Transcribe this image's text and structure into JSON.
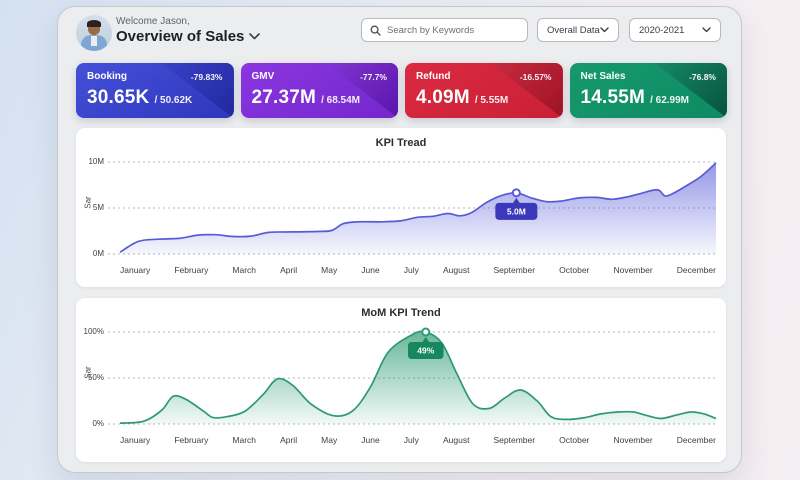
{
  "header": {
    "welcome": "Welcome Jason,",
    "title": "Overview of Sales",
    "search_placeholder": "Search by Keywords",
    "data_filter": "Overall Data",
    "year_filter": "2020-2021"
  },
  "icons": {
    "search": "magnifier",
    "title_dropdown": "chevron-down",
    "filter_dropdown": "chevron-down"
  },
  "cards": [
    {
      "label": "Booking",
      "value": "30.65K",
      "secondary": "/ 50.62K",
      "delta": "-79.83%",
      "color_from": "#4450d8",
      "color_to": "#2f36bd",
      "corner_from": "#4a52e2",
      "corner_to": "#21289e"
    },
    {
      "label": "GMV",
      "value": "27.37M",
      "secondary": "/ 68.54M",
      "delta": "-77.7%",
      "color_from": "#8a36e0",
      "color_to": "#7427cc",
      "corner_from": "#9b4ceb",
      "corner_to": "#5a15ab"
    },
    {
      "label": "Refund",
      "value": "4.09M",
      "secondary": "/ 5.55M",
      "delta": "-16.57%",
      "color_from": "#da2a41",
      "color_to": "#c92036",
      "corner_from": "#e33c52",
      "corner_to": "#9e1226"
    },
    {
      "label": "Net Sales",
      "value": "14.55M",
      "secondary": "/ 62.99M",
      "delta": "-76.8%",
      "color_from": "#16996e",
      "color_to": "#0d8a61",
      "corner_from": "#1fae81",
      "corner_to": "#07523c"
    }
  ],
  "chart_data": [
    {
      "type": "area",
      "title": "KPI Tread",
      "ylabel": "Sar",
      "unit": "M",
      "ylim": [
        0,
        10
      ],
      "yticks": [
        "10M",
        "5M",
        "0M"
      ],
      "grid": "dashed",
      "categories": [
        "January",
        "February",
        "March",
        "April",
        "May",
        "June",
        "July",
        "August",
        "September",
        "October",
        "November",
        "December"
      ],
      "values": [
        0.3,
        2.0,
        2.0,
        2.4,
        2.6,
        3.5,
        4.1,
        6.4,
        6.6,
        6.0,
        6.9,
        9.9
      ],
      "tooltip": {
        "label": "5.0M",
        "month": "September"
      },
      "marker": {
        "x": 0.665,
        "value": 6.65
      },
      "line_color": "#585cd4",
      "fill_color": "#6b6fdd",
      "tooltip_color": "#3b38bb",
      "curve": [
        [
          0,
          0.2
        ],
        [
          0.03,
          1.35
        ],
        [
          0.06,
          1.6
        ],
        [
          0.1,
          1.7
        ],
        [
          0.13,
          2.05
        ],
        [
          0.16,
          2.1
        ],
        [
          0.19,
          1.9
        ],
        [
          0.22,
          1.95
        ],
        [
          0.25,
          2.35
        ],
        [
          0.29,
          2.4
        ],
        [
          0.33,
          2.45
        ],
        [
          0.355,
          2.55
        ],
        [
          0.375,
          3.3
        ],
        [
          0.4,
          3.5
        ],
        [
          0.44,
          3.5
        ],
        [
          0.47,
          3.6
        ],
        [
          0.5,
          4.0
        ],
        [
          0.525,
          4.1
        ],
        [
          0.55,
          4.4
        ],
        [
          0.57,
          4.15
        ],
        [
          0.59,
          4.5
        ],
        [
          0.615,
          5.6
        ],
        [
          0.64,
          6.35
        ],
        [
          0.665,
          6.65
        ],
        [
          0.69,
          6.1
        ],
        [
          0.715,
          5.7
        ],
        [
          0.74,
          5.75
        ],
        [
          0.77,
          6.1
        ],
        [
          0.8,
          6.15
        ],
        [
          0.825,
          5.95
        ],
        [
          0.85,
          6.2
        ],
        [
          0.875,
          6.6
        ],
        [
          0.895,
          6.95
        ],
        [
          0.905,
          6.9
        ],
        [
          0.915,
          6.3
        ],
        [
          0.93,
          6.65
        ],
        [
          0.95,
          7.4
        ],
        [
          0.97,
          8.2
        ],
        [
          0.985,
          9.0
        ],
        [
          1.0,
          9.9
        ]
      ]
    },
    {
      "type": "area",
      "title": "MoM KPI Trend",
      "ylabel": "Sar",
      "unit": "%",
      "ylim": [
        0,
        100
      ],
      "yticks": [
        "100%",
        "50%",
        "0%"
      ],
      "grid": "dashed",
      "categories": [
        "January",
        "February",
        "March",
        "April",
        "May",
        "June",
        "July",
        "August",
        "September",
        "October",
        "November",
        "December"
      ],
      "values": [
        1,
        30,
        7,
        49,
        9,
        78,
        100,
        20,
        37,
        8,
        13,
        10
      ],
      "tooltip": {
        "label": "49%",
        "month": "July"
      },
      "marker": {
        "x": 0.513,
        "value": 100
      },
      "line_color": "#2e9974",
      "fill_color": "#2c9c74",
      "tooltip_color": "#17875f",
      "curve": [
        [
          0,
          1
        ],
        [
          0.04,
          3
        ],
        [
          0.07,
          15
        ],
        [
          0.089,
          30
        ],
        [
          0.11,
          27
        ],
        [
          0.14,
          14
        ],
        [
          0.156,
          7
        ],
        [
          0.18,
          8
        ],
        [
          0.21,
          14
        ],
        [
          0.24,
          32
        ],
        [
          0.264,
          49
        ],
        [
          0.29,
          42
        ],
        [
          0.32,
          22
        ],
        [
          0.358,
          9
        ],
        [
          0.39,
          14
        ],
        [
          0.42,
          40
        ],
        [
          0.45,
          78
        ],
        [
          0.49,
          97
        ],
        [
          0.513,
          100
        ],
        [
          0.54,
          88
        ],
        [
          0.565,
          55
        ],
        [
          0.592,
          22
        ],
        [
          0.62,
          17
        ],
        [
          0.645,
          28
        ],
        [
          0.672,
          37
        ],
        [
          0.7,
          25
        ],
        [
          0.723,
          8
        ],
        [
          0.75,
          5
        ],
        [
          0.78,
          7
        ],
        [
          0.807,
          11
        ],
        [
          0.835,
          13
        ],
        [
          0.862,
          13
        ],
        [
          0.885,
          9
        ],
        [
          0.908,
          6
        ],
        [
          0.935,
          10
        ],
        [
          0.958,
          13
        ],
        [
          0.98,
          11
        ],
        [
          1.0,
          6
        ]
      ]
    }
  ]
}
